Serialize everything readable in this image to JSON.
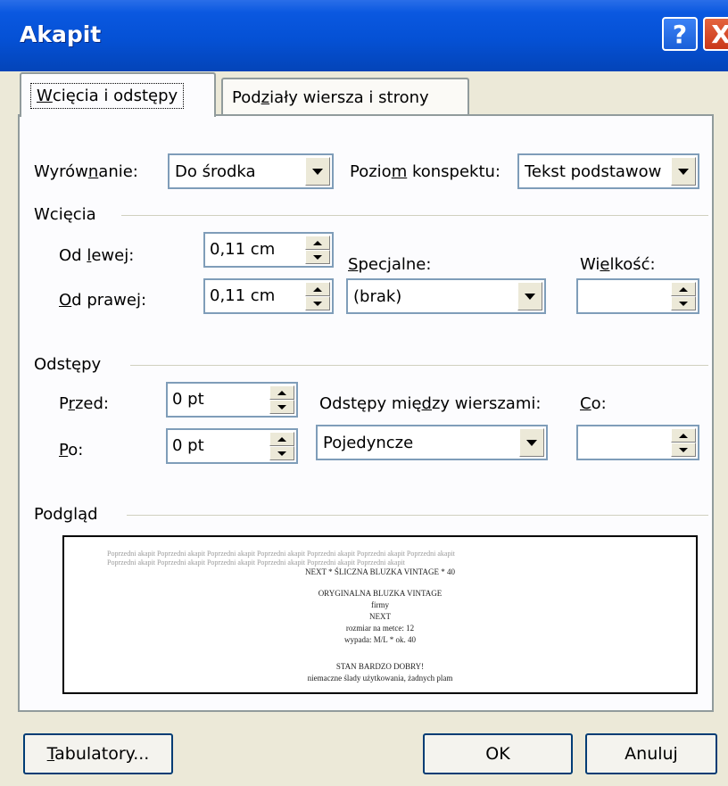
{
  "window": {
    "title": "Akapit"
  },
  "tabs": [
    {
      "label": "Wcięcia i odstępy",
      "mnemonic": "W"
    },
    {
      "label": "Podziały wiersza i strony",
      "mnemonic": "z"
    }
  ],
  "general": {
    "alignment_label_pre": "Wyrów",
    "alignment_label_mn": "n",
    "alignment_label_post": "anie:",
    "alignment_value": "Do środka",
    "outline_label_pre": "Pozio",
    "outline_label_mn": "m",
    "outline_label_post": " konspektu:",
    "outline_value": "Tekst podstawow"
  },
  "indent": {
    "group_label": "Wcięcia",
    "left_label_pre": "Od ",
    "left_label_mn": "l",
    "left_label_post": "ewej:",
    "left_value": "0,11 cm",
    "right_label_mn": "O",
    "right_label_post": "d prawej:",
    "right_value": "0,11 cm",
    "special_label_mn": "S",
    "special_label_post": "pecjalne:",
    "special_value": "(brak)",
    "by_label_pre": "Wi",
    "by_label_mn": "e",
    "by_label_post": "lkość:",
    "by_value": ""
  },
  "spacing": {
    "group_label": "Odstępy",
    "before_label_pre": "P",
    "before_label_mn": "r",
    "before_label_post": "zed:",
    "before_value": "0 pt",
    "after_label_mn": "P",
    "after_label_post": "o:",
    "after_value": "0 pt",
    "line_label_pre": "Odstępy mię",
    "line_label_mn": "d",
    "line_label_post": "zy wierszami:",
    "line_value": "Pojedyncze",
    "at_label_mn": "C",
    "at_label_post": "o:",
    "at_value": ""
  },
  "preview": {
    "group_label": "Podgląd",
    "prev_line1": "Poprzedni akapit Poprzedni akapit Poprzedni akapit Poprzedni akapit Poprzedni akapit Poprzedni akapit Poprzedni akapit",
    "prev_line2": "Poprzedni akapit Poprzedni akapit Poprzedni akapit Poprzedni akapit Poprzedni akapit Poprzedni akapit",
    "lines": [
      "NEXT * ŚLICZNA BLUZKA VINTAGE * 40",
      "ORYGINALNA BLUZKA VINTAGE",
      "firmy",
      "NEXT",
      "rozmiar na metce: 12",
      "wypada: M/L * ok. 40",
      "STAN BARDZO DOBRY!",
      "niemaczne ślady użytkowania, żadnych plam"
    ]
  },
  "buttons": {
    "tabs_pre": "",
    "tabs_mn": "T",
    "tabs_post": "abulatory...",
    "ok": "OK",
    "cancel": "Anuluj"
  },
  "icons": {
    "help": "?",
    "close": "X"
  }
}
